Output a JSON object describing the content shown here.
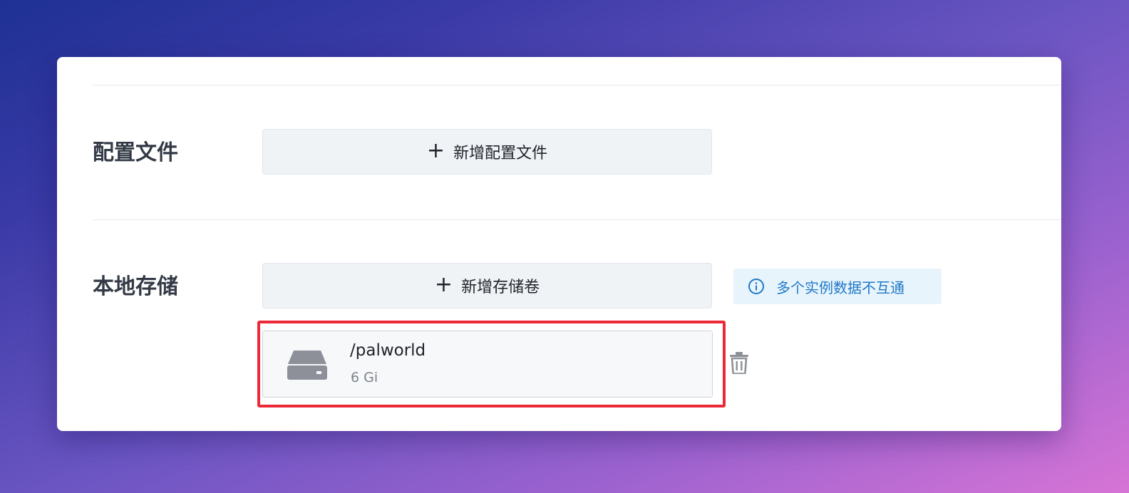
{
  "config_section": {
    "label": "配置文件",
    "add_button_label": "新增配置文件"
  },
  "storage_section": {
    "label": "本地存储",
    "add_button_label": "新增存储卷",
    "tip_text": "多个实例数据不互通",
    "volumes": [
      {
        "path": "/palworld",
        "size": "6 Gi"
      }
    ]
  },
  "icons": {
    "plus": "plus-icon",
    "info": "info-icon",
    "disk": "hard-disk-icon",
    "delete": "trash-icon"
  },
  "colors": {
    "highlight": "#ec2a37",
    "tip_text": "#1e78c7",
    "tip_background": "#e8f4fc",
    "button_background": "#f0f3f6"
  }
}
